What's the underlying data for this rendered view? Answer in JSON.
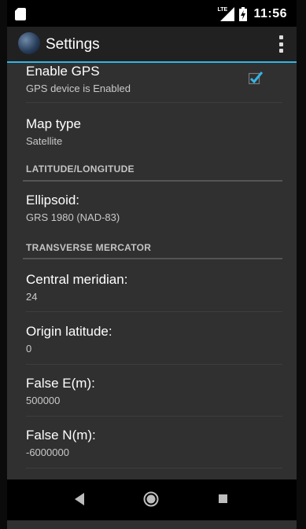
{
  "status_bar": {
    "time": "11:56",
    "network": "LTE"
  },
  "app_bar": {
    "title": "Settings",
    "accent_color": "#33b5e5"
  },
  "preferences": [
    {
      "title": "Enable GPS",
      "summary": "GPS device is Enabled",
      "checked": true
    },
    {
      "title": "Map type",
      "summary": "Satellite"
    }
  ],
  "categories": {
    "latlon": {
      "label": "LATITUDE/LONGITUDE"
    },
    "tm": {
      "label": "TRANSVERSE MERCATOR"
    }
  },
  "latlon_prefs": [
    {
      "title": "Ellipsoid:",
      "summary": "GRS 1980 (NAD-83)"
    }
  ],
  "tm_prefs": [
    {
      "title": "Central meridian:",
      "summary": "24"
    },
    {
      "title": "Origin latitude:",
      "summary": "0"
    },
    {
      "title": "False E(m):",
      "summary": "500000"
    },
    {
      "title": "False N(m):",
      "summary": "-6000000"
    }
  ]
}
